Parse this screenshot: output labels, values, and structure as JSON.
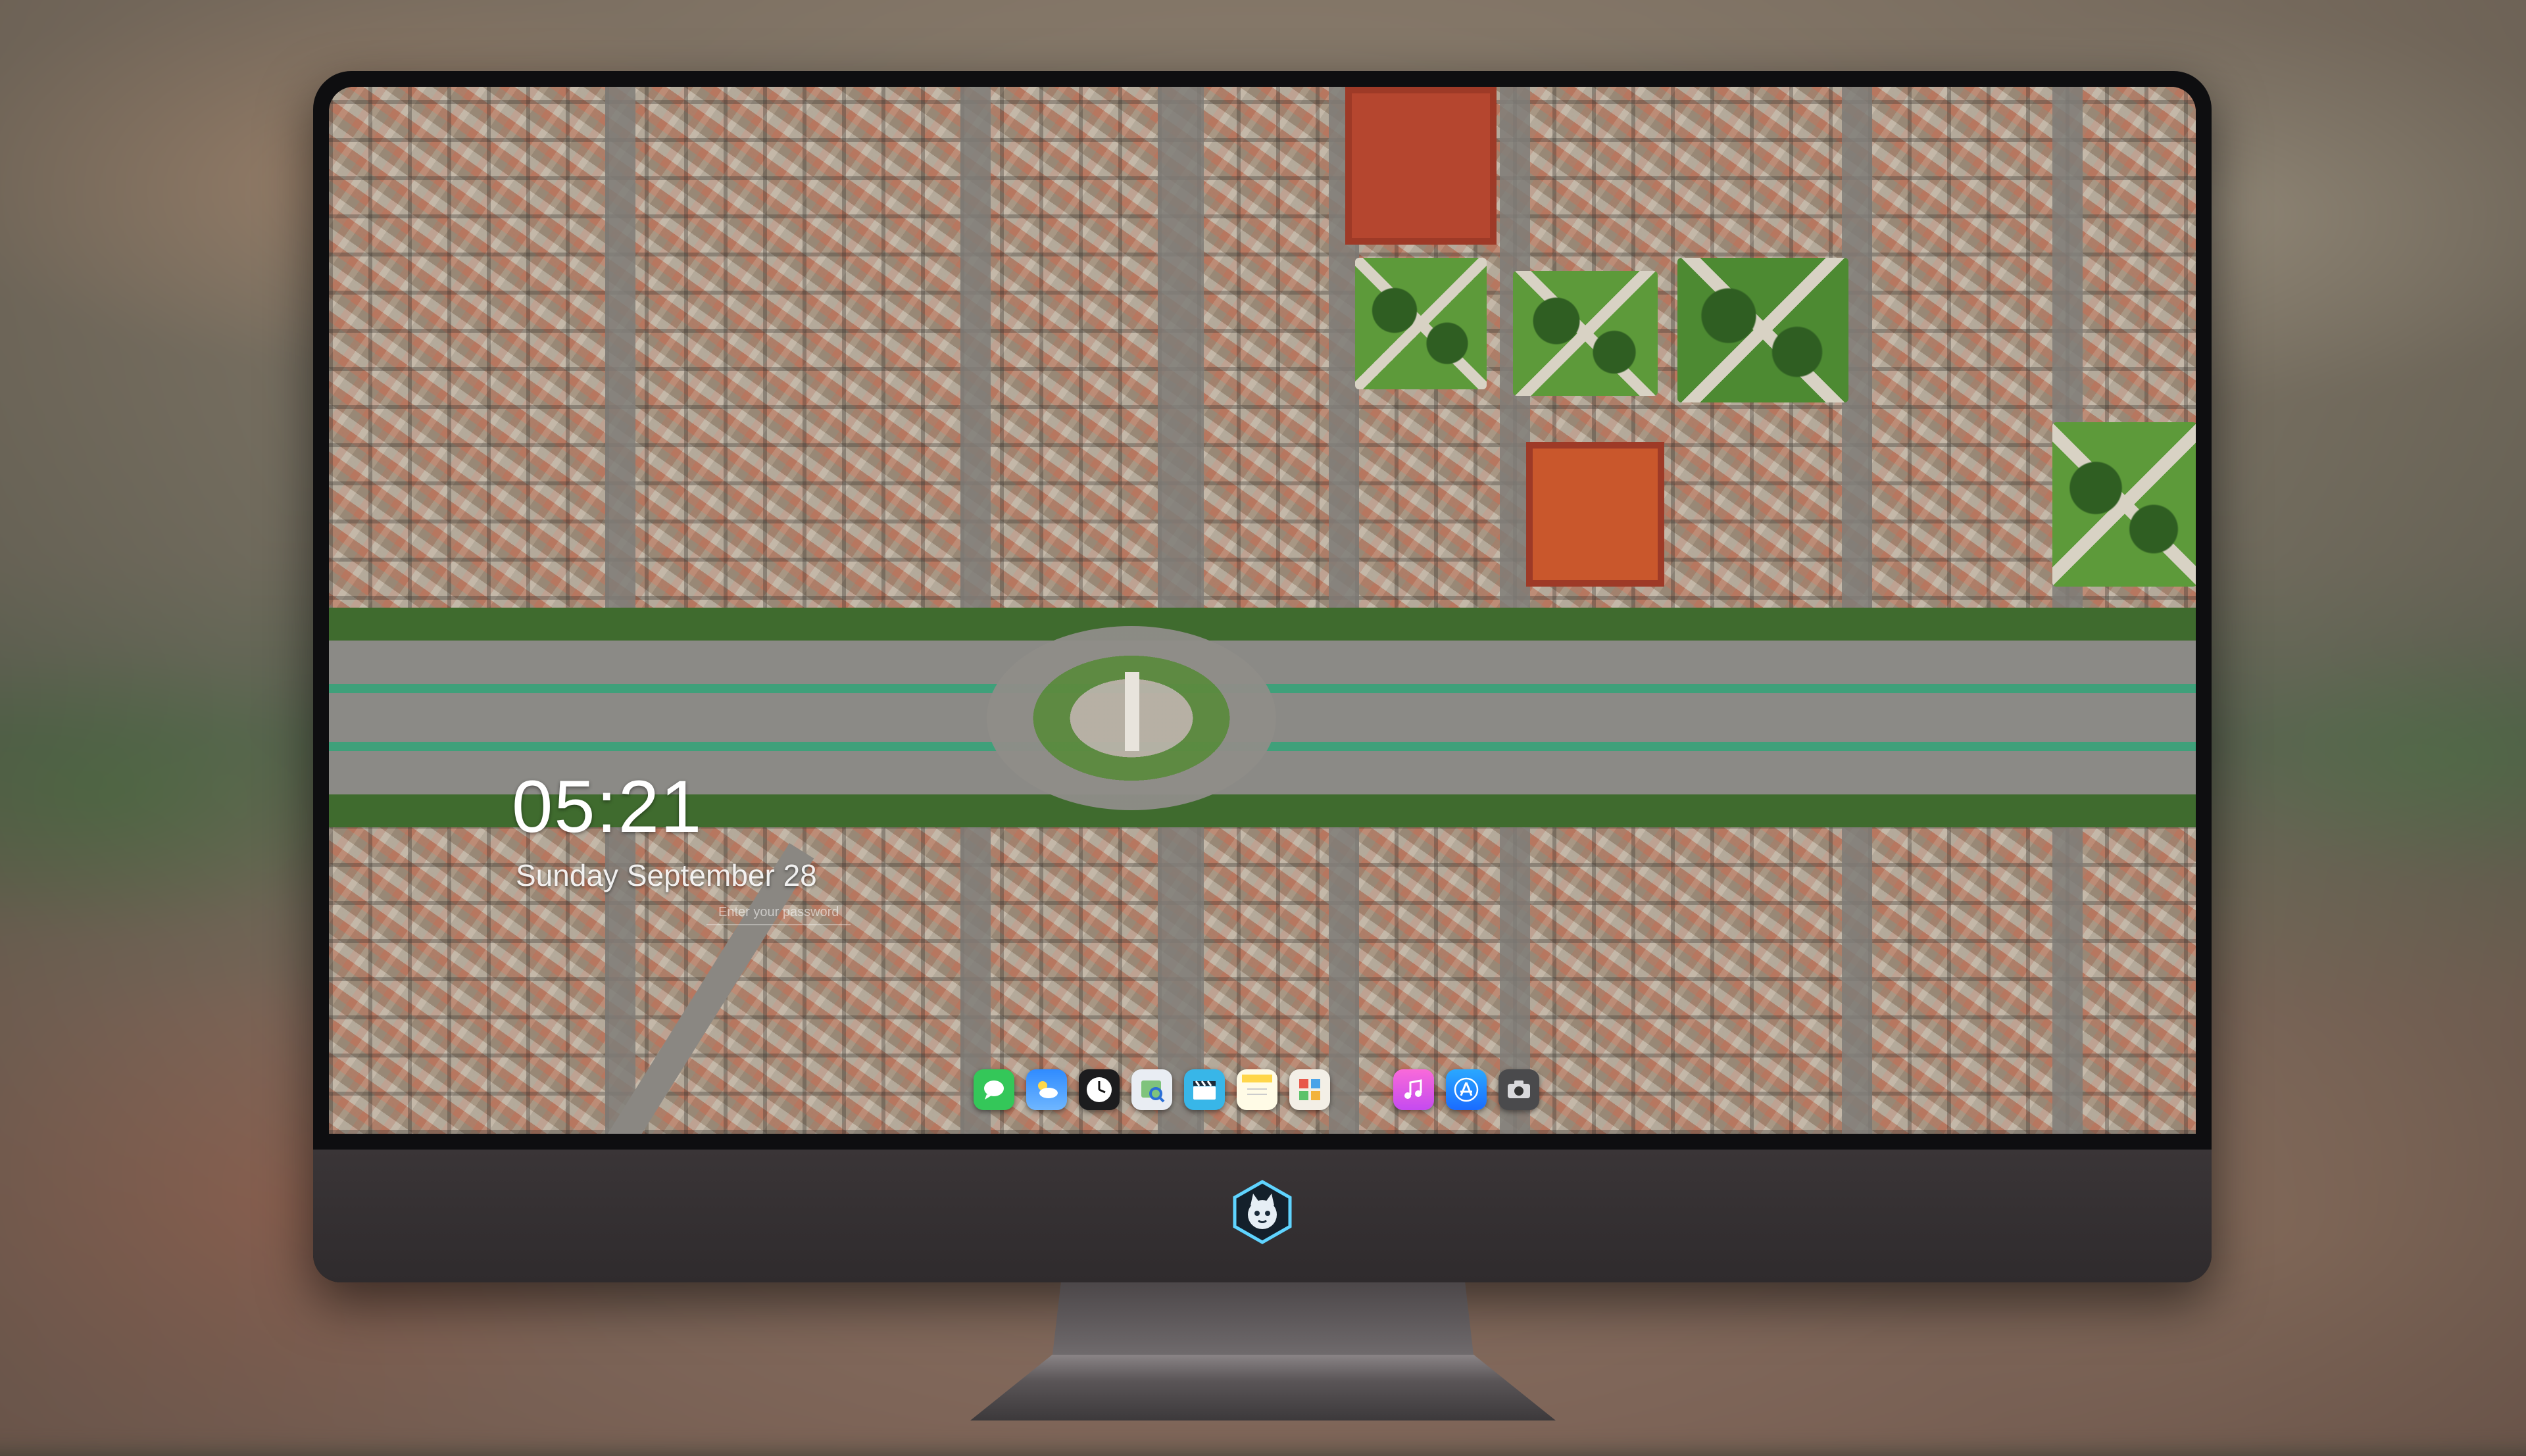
{
  "lockscreen": {
    "time": "05:21",
    "date": "Sunday September  28",
    "password_hint": "Enter your password"
  },
  "dock": {
    "items": [
      {
        "name": "messages-icon",
        "color": "#34c759"
      },
      {
        "name": "weather-icon",
        "color": "#2f8bff"
      },
      {
        "name": "clock-icon",
        "color": "#1c1c1e"
      },
      {
        "name": "preview-icon",
        "color": "#e9edf3"
      },
      {
        "name": "claquette-icon",
        "color": "#38b6e8"
      },
      {
        "name": "notes-icon",
        "color": "#ffd64a"
      },
      {
        "name": "photo-booth-icon",
        "color": "#f3efe6"
      },
      {
        "name": "music-icon",
        "color": "#f04fd7"
      },
      {
        "name": "app-store-icon",
        "color": "#1a8cff"
      },
      {
        "name": "camera-icon",
        "color": "#4a4a4c"
      }
    ]
  },
  "monitor": {
    "logo": "cat-mascot-logo"
  }
}
